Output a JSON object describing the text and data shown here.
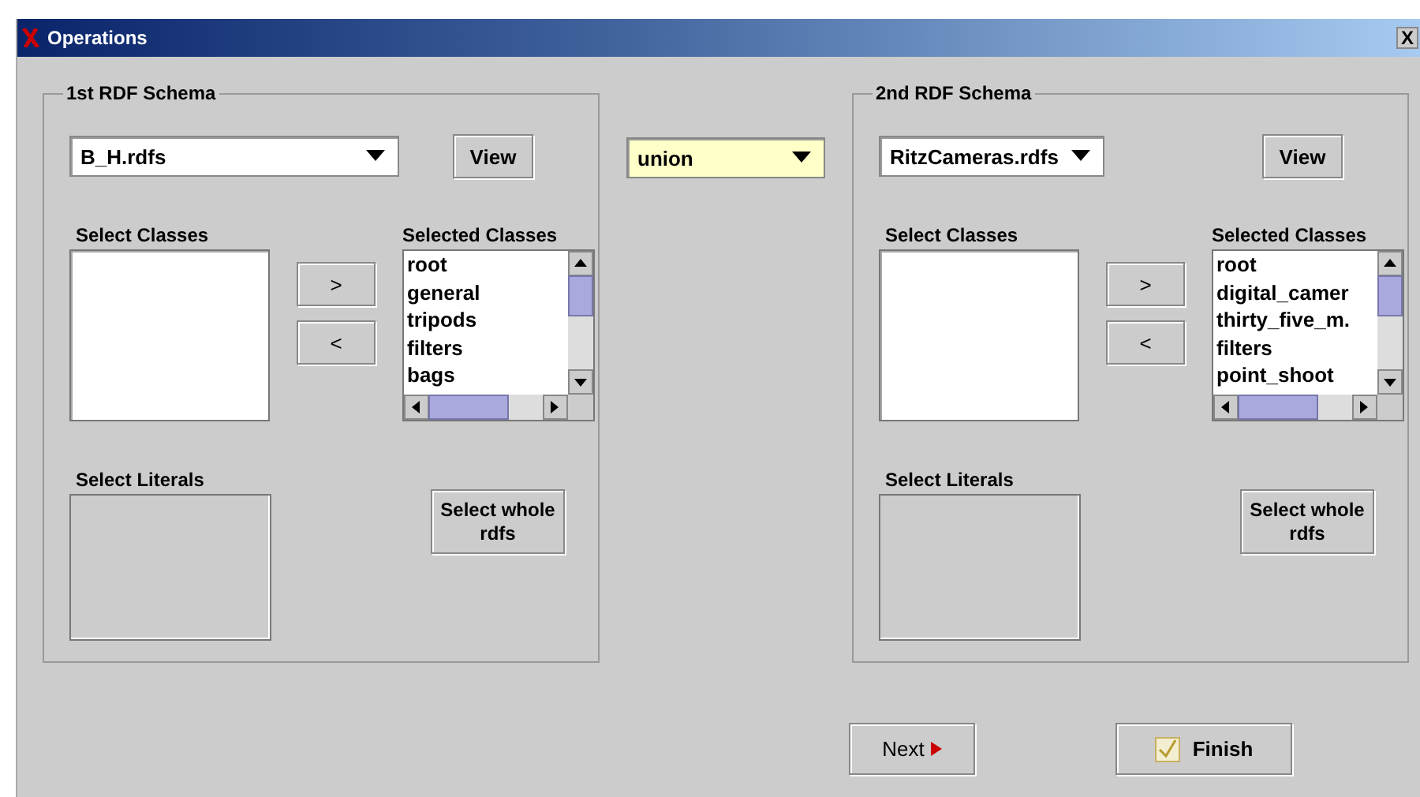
{
  "window": {
    "title": "Operations",
    "close": "X"
  },
  "schemas": [
    {
      "title": "1st RDF Schema",
      "file": "B_H.rdfs",
      "view_button": "View",
      "select_classes_label": "Select Classes",
      "add_button": ">",
      "remove_button": "<",
      "selected_classes_label": "Selected Classes",
      "selected_classes": [
        "root",
        "general",
        "tripods",
        "filters",
        "bags"
      ],
      "select_literals_label": "Select Literals",
      "select_whole_button": "Select whole rdfs"
    },
    {
      "title": "2nd RDF Schema",
      "file": "RitzCameras.rdfs",
      "view_button": "View",
      "select_classes_label": "Select Classes",
      "add_button": ">",
      "remove_button": "<",
      "selected_classes_label": "Selected Classes",
      "selected_classes": [
        "root",
        "digital_camer",
        "thirty_five_m.",
        "filters",
        "point_shoot"
      ],
      "select_literals_label": "Select Literals",
      "select_whole_button": "Select whole rdfs"
    }
  ],
  "operation": "union",
  "buttons": {
    "next": "Next",
    "finish": "Finish"
  }
}
